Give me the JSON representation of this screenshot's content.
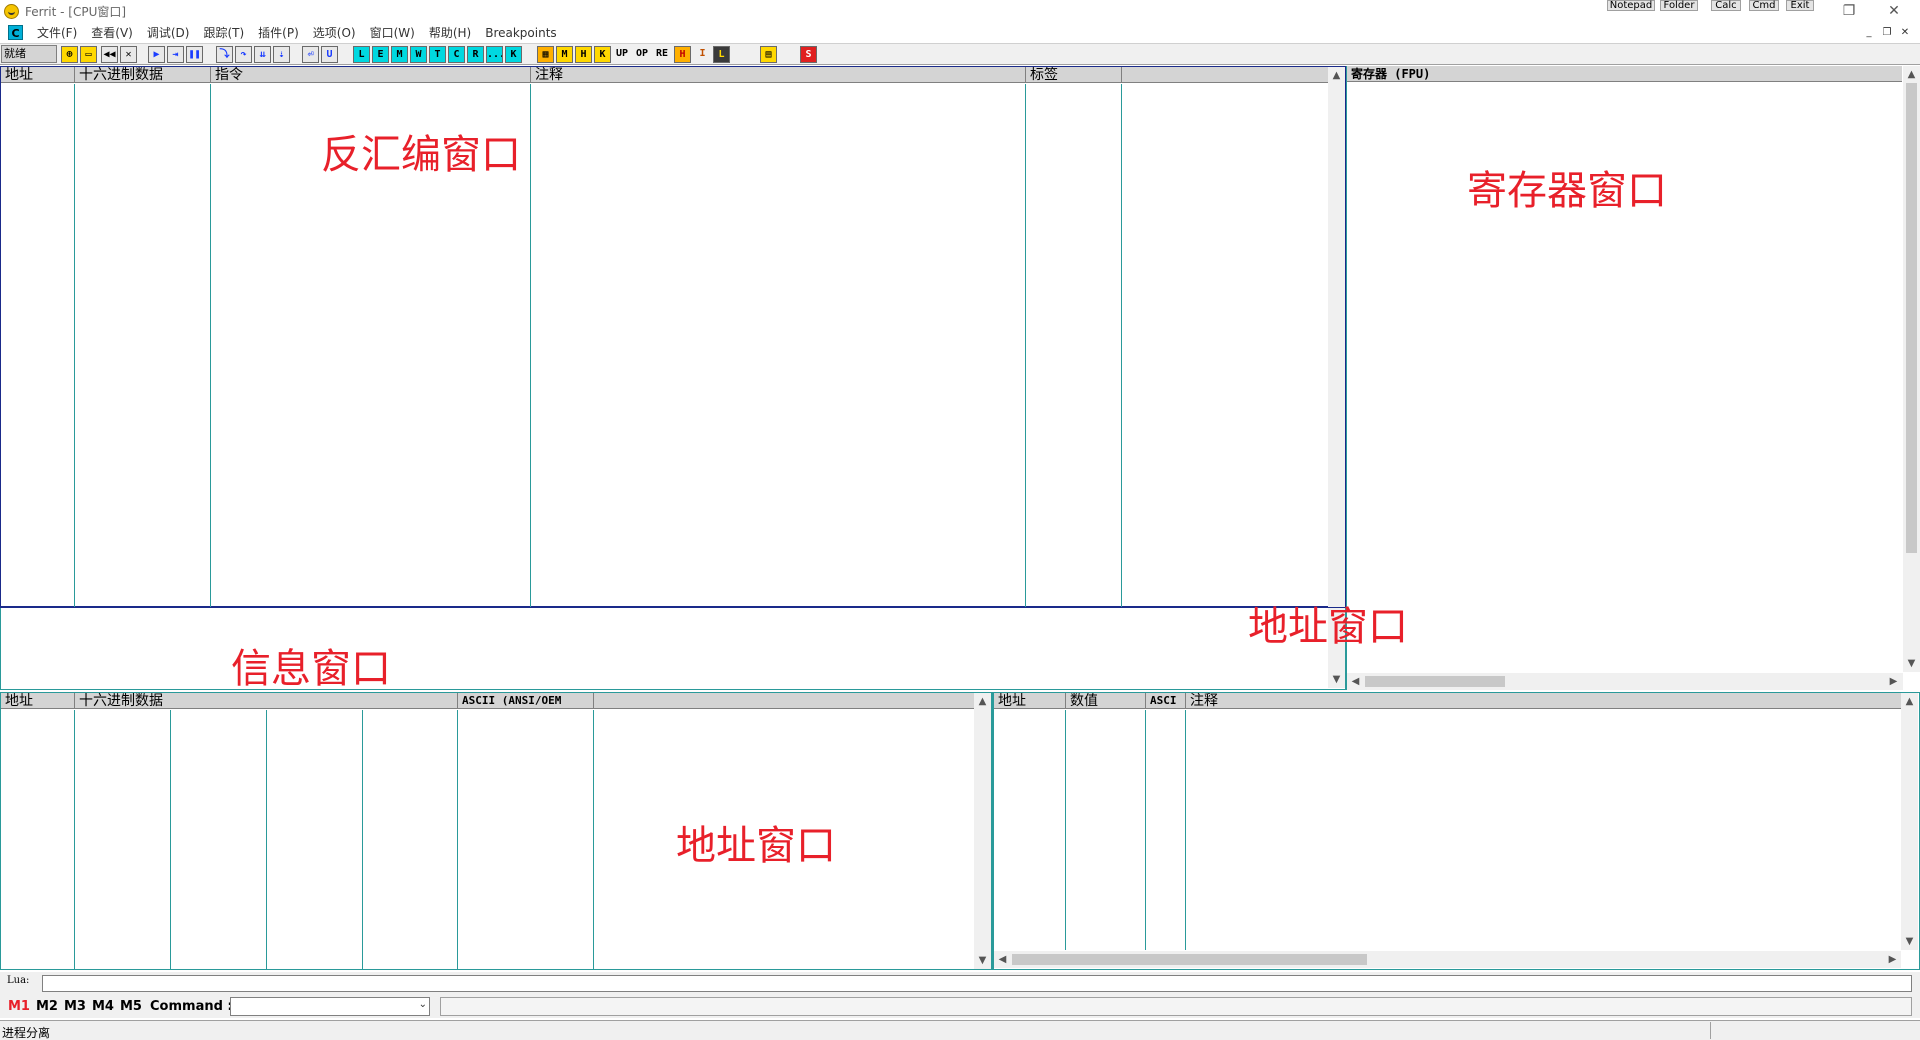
{
  "window": {
    "title": "Ferrit - [CPU窗口]",
    "app_buttons": [
      "Notepad",
      "Folder",
      "Calc",
      "Cmd",
      "Exit"
    ]
  },
  "menu": {
    "c_icon": "C",
    "items": [
      "文件(F)",
      "查看(V)",
      "调试(D)",
      "跟踪(T)",
      "插件(P)",
      "选项(O)",
      "窗口(W)",
      "帮助(H)",
      "Breakpoints"
    ]
  },
  "toolbar": {
    "status": "就绪",
    "letter_buttons": [
      "L",
      "E",
      "M",
      "W",
      "T",
      "C",
      "R",
      "...",
      "K"
    ],
    "extra_buttons": [
      "M",
      "H",
      "K",
      "UP",
      "OP",
      "RE",
      "H",
      "I",
      "L"
    ]
  },
  "disasm": {
    "columns": [
      "地址",
      "十六进制数据",
      "指令",
      "注释",
      "标签",
      ""
    ],
    "annotation": "反汇编窗口"
  },
  "registers": {
    "header": "寄存器 (FPU)",
    "annotation": "寄存器窗口"
  },
  "info": {
    "annotation": "信息窗口",
    "overlay_annotation": "地址窗口"
  },
  "dump": {
    "columns": [
      "地址",
      "十六进制数据",
      "ASCII (ANSI/OEM",
      ""
    ],
    "annotation": "地址窗口"
  },
  "stack": {
    "columns": [
      "地址",
      "数值",
      "ASCI",
      "注释"
    ]
  },
  "lua": {
    "label": "Lua:",
    "value": ""
  },
  "command_bar": {
    "macros": [
      "M1",
      "M2",
      "M3",
      "M4",
      "M5"
    ],
    "command_label": "Command :",
    "command_value": "",
    "accent": "#e8202a"
  },
  "statusbar": {
    "text": "进程分离"
  },
  "colors": {
    "annotation": "#e8202a",
    "grid_line": "#2a9a9a",
    "pane_border": "#1a2a8a"
  }
}
